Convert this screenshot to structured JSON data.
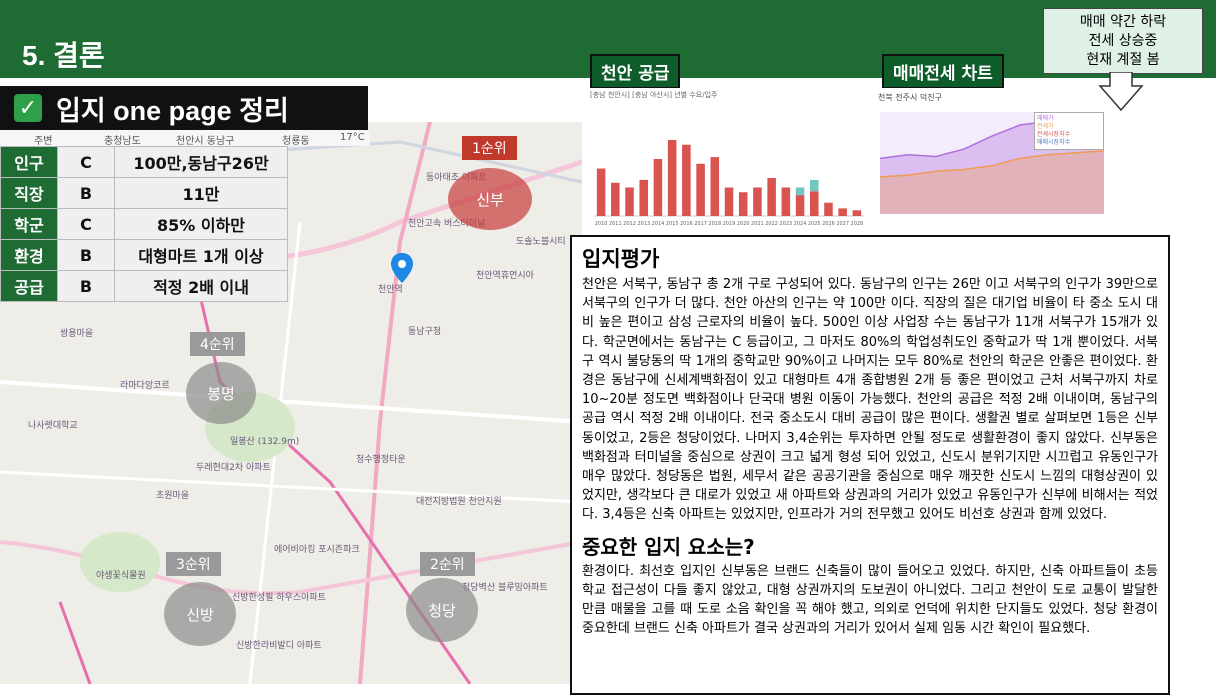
{
  "slide": {
    "title": "5. 결론"
  },
  "heading": {
    "text": "입지 one page 정리"
  },
  "map_breadcrumb": {
    "home": "주변",
    "region": "충청남도",
    "city": "천안시 동남구",
    "district": "청룡동",
    "weather": "17°C"
  },
  "grades": [
    {
      "key": "인구",
      "grade": "C",
      "value": "100만,동남구26만"
    },
    {
      "key": "직장",
      "grade": "B",
      "value": "11만"
    },
    {
      "key": "학군",
      "grade": "C",
      "value": "85%  이하만"
    },
    {
      "key": "환경",
      "grade": "B",
      "value": "대형마트 1개 이상"
    },
    {
      "key": "공급",
      "grade": "B",
      "value": "적정 2배 이내"
    }
  ],
  "rankings": [
    {
      "rank": "1순위",
      "area": "신부"
    },
    {
      "rank": "2순위",
      "area": "청당"
    },
    {
      "rank": "3순위",
      "area": "신방"
    },
    {
      "rank": "4순위",
      "area": "봉명"
    }
  ],
  "map_labels": [
    "동아태조 아파트",
    "천안고속 버스터미널",
    "도솔노블시티",
    "천안역휴먼시아",
    "천안역",
    "동남구청",
    "쌍용마을",
    "일봉산 (132.9m)",
    "두레현대2차 아파트",
    "나사렛대학교",
    "초원마을",
    "청수행정타운",
    "대전지방법원 천안지원",
    "에어비아킹 포시즌파크",
    "야생꽃식물원",
    "신방한성필 하우스아파트",
    "신방한라비발디 아파트",
    "청당벽산 블루밍아파트",
    "라마다앙코르"
  ],
  "labels": {
    "supply": "천안 공급",
    "chart": "매매전세 차트"
  },
  "supply_chart": {
    "header": "[충남 천안시] [충남 아산시] 년별 수요/입주"
  },
  "price_chart": {
    "header": "천북 전주시 덕진구",
    "legend": [
      "매매가",
      "전세가",
      "전세시장지수",
      "매매시장지수"
    ]
  },
  "callout": {
    "line1": "매매 약간 하락",
    "line2": "전세 상승중",
    "line3": "현재 계절 봄"
  },
  "evaluation": {
    "title": "입지평가",
    "body": "천안은 서북구, 동남구 총 2개 구로 구성되어 있다. 동남구의 인구는 26만 이고 서북구의 인구가 39만으로 서북구의 인구가 더 많다. 천안 아산의 인구는 약 100만 이다. 직장의 질은 대기업 비율이 타 중소 도시 대비 높은 편이고 삼성 근로자의 비율이 높다. 500인 이상 사업장 수는 동남구가 11개 서북구가 15개가 있다. 학군면에서는 동남구는 C 등급이고, 그 마저도 80%의 학업성취도인 중학교가 딱 1개 뿐이었다. 서북구 역시 불당동의 딱 1개의 중학교만 90%이고 나머지는 모두 80%로 천안의 학군은 안좋은 편이었다. 환경은 동남구에 신세계백화점이 있고 대형마트 4개 종합병원 2개 등 좋은 편이었고 근처 서북구까지 차로 10~20분 정도면 백화점이나 단국대 병원 이동이 가능했다. 천안의 공급은 적정 2배 이내이며, 동남구의 공급 역시 적정 2배 이내이다. 전국 중소도시 대비 공급이 많은 편이다. 생활권 별로 살펴보면 1등은 신부동이었고, 2등은 청당이었다. 나머지 3,4순위는 투자하면 안될 정도로 생활환경이 좋지 않았다. 신부동은 백화점과 터미널을 중심으로 상권이 크고 넓게 형성 되어 있었고, 신도시 분위기지만 시끄럽고 유동인구가 매우 많았다. 청당동은 법원, 세무서 같은 공공기관을 중심으로 매우 깨끗한 신도시 느낌의 대형상권이 있었지만, 생각보다 큰 대로가 있었고 새 아파트와 상권과의 거리가 있었고 유동인구가 신부에 비해서는 적었다. 3,4등은 신축 아파트는 있었지만, 인프라가 거의 전무했고 있어도 비선호 상권과 함께 있었다.",
    "subtitle": "중요한 입지 요소는?",
    "body2": "환경이다. 최선호 입지인 신부동은 브랜드 신축들이 많이 들어오고 있었다. 하지만, 신축 아파트들이 초등학교 접근성이 다들 좋지 않았고, 대형 상권까지의 도보권이 아니었다. 그리고 천안이 도로 교통이 발달한 만큼 매물을 고를 때 도로 소음 확인을 꼭 해야 했고, 의외로 언덕에 위치한 단지들도 있었다. 청당 환경이 중요한데 브랜드 신축 아파트가 결국 상권과의 거리가 있어서 실제 임동 시간 확인이 필요했다."
  },
  "chart_data": [
    {
      "type": "bar",
      "title": "",
      "categories": [
        "2010",
        "2011",
        "2012",
        "2013",
        "2014",
        "2015",
        "2016",
        "2017",
        "2018",
        "2019",
        "2020",
        "2021",
        "2022",
        "2023",
        "2024",
        "2025",
        "2026",
        "2027",
        "2028"
      ],
      "series": [
        {
          "name": "",
          "values": [
            5000,
            3500,
            3000,
            3800,
            6000,
            8000,
            7500,
            5500,
            6200,
            3000,
            2500,
            3000,
            4000,
            3000,
            2200,
            2600,
            1400,
            800,
            600
          ],
          "color": "#d9534f"
        },
        {
          "name": "",
          "values": [
            0,
            0,
            0,
            0,
            0,
            0,
            0,
            0,
            0,
            0,
            0,
            0,
            0,
            0,
            800,
            1200,
            0,
            0,
            0
          ],
          "color": "#6fc7bd"
        }
      ],
      "ylim": [
        0,
        12000
      ]
    },
    {
      "type": "line",
      "title": "",
      "series": [
        {
          "name": "매매가",
          "values": [
            300,
            320,
            310,
            350,
            420,
            480,
            500,
            470,
            460
          ],
          "color": "#b06ee0"
        },
        {
          "name": "전세가",
          "values": [
            200,
            210,
            230,
            240,
            260,
            300,
            320,
            330,
            340
          ],
          "color": "#f29a54"
        }
      ]
    }
  ]
}
